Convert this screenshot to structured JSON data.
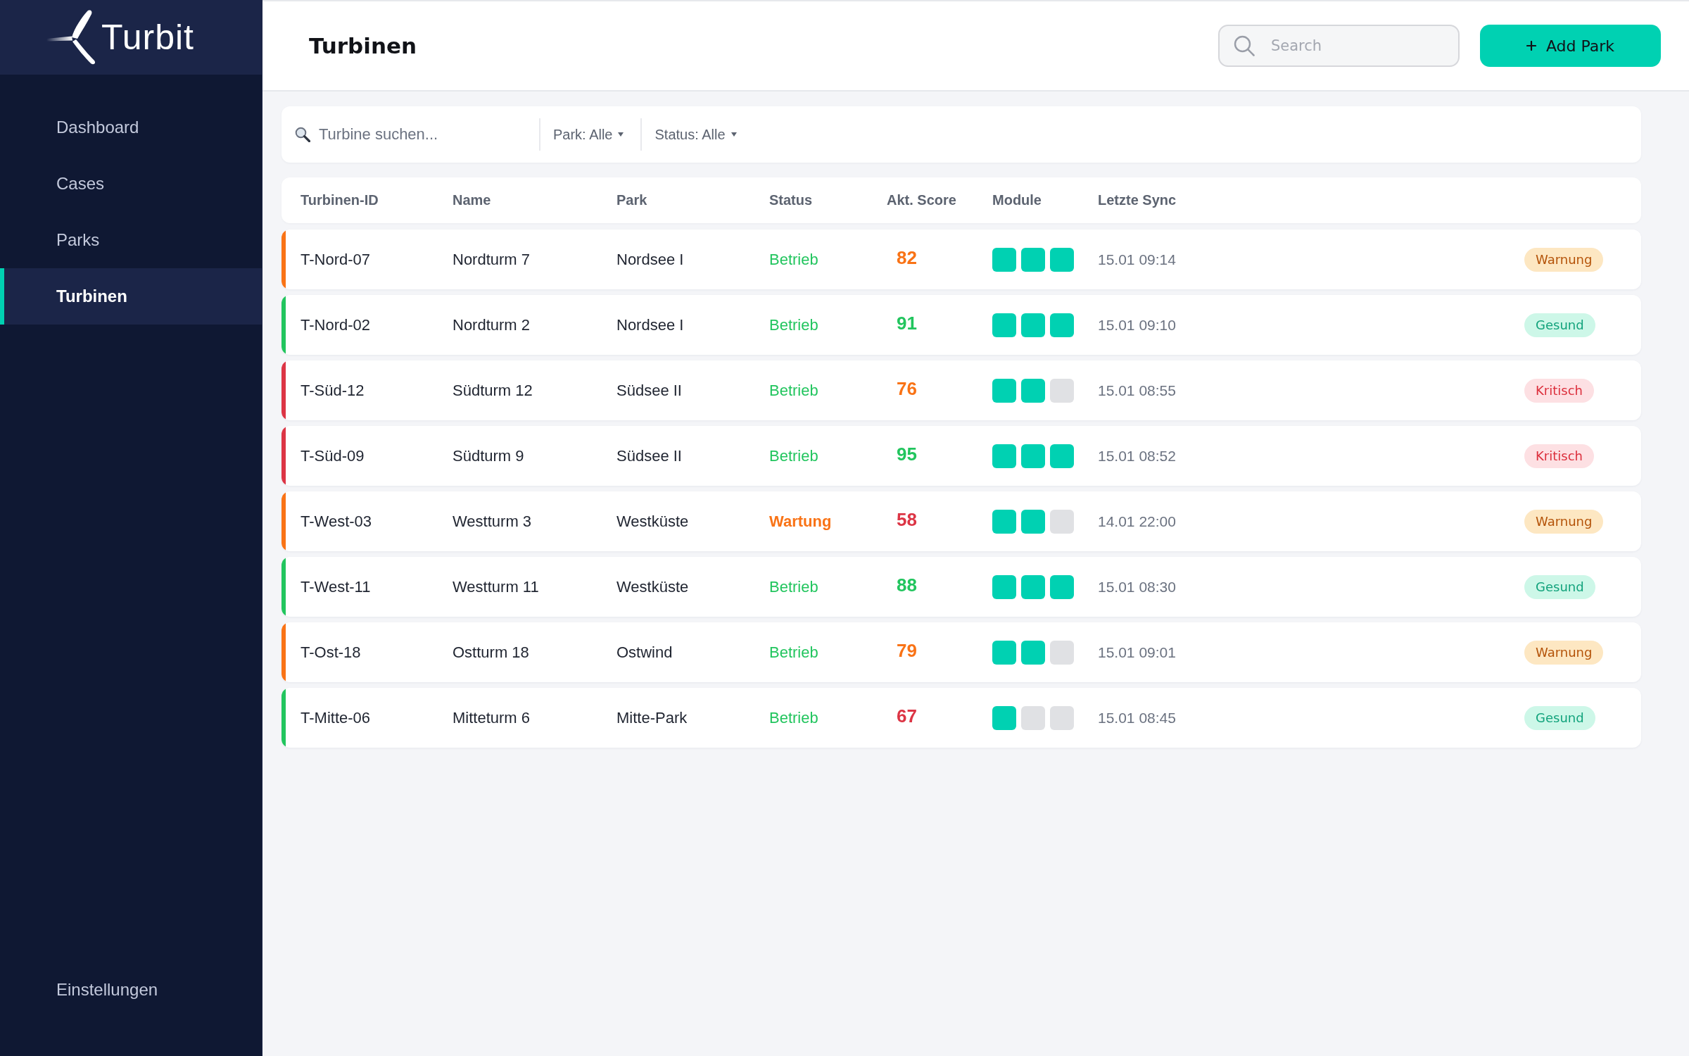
{
  "sidebar": {
    "logo": {
      "text": "Turbit"
    },
    "items": [
      {
        "label": "Dashboard",
        "selected": false
      },
      {
        "label": "Cases",
        "selected": false
      },
      {
        "label": "Parks",
        "selected": false
      },
      {
        "label": "Turbinen",
        "selected": true
      }
    ],
    "footer_items": [
      {
        "label": "Einstellungen",
        "selected": false
      }
    ]
  },
  "header": {
    "title": "Turbinen",
    "search": {
      "placeholder": "Search"
    },
    "add_button": {
      "label": "Add Park"
    }
  },
  "filters": {
    "search": {
      "placeholder": "Turbine suchen..."
    },
    "dropdowns": [
      {
        "label": "Park: Alle"
      },
      {
        "label": "Status: Alle"
      }
    ]
  },
  "table": {
    "columns": [
      "Turbinen-ID",
      "Name",
      "Park",
      "Status",
      "Akt. Score",
      "Module",
      "Letzte Sync"
    ],
    "rows": [
      {
        "color": "#f97316",
        "id": "T-Nord-07",
        "name": "Nordturm 7",
        "park": "Nordsee I",
        "status": {
          "label": "Betrieb",
          "kind": "running"
        },
        "score": {
          "value": "82",
          "color": "#f97316"
        },
        "modules": [
          {
            "on": true
          },
          {
            "on": true
          },
          {
            "on": true
          }
        ],
        "sync": "15.01 09:14",
        "badge": {
          "label": "Warnung",
          "kind": "warning"
        }
      },
      {
        "color": "#22c55e",
        "id": "T-Nord-02",
        "name": "Nordturm 2",
        "park": "Nordsee I",
        "status": {
          "label": "Betrieb",
          "kind": "running"
        },
        "score": {
          "value": "91",
          "color": "#22c55e"
        },
        "modules": [
          {
            "on": true
          },
          {
            "on": true
          },
          {
            "on": true
          }
        ],
        "sync": "15.01 09:10",
        "badge": {
          "label": "Gesund",
          "kind": "healthy"
        }
      },
      {
        "color": "#dc3545",
        "id": "T-Süd-12",
        "name": "Südturm 12",
        "park": "Südsee II",
        "status": {
          "label": "Betrieb",
          "kind": "running"
        },
        "score": {
          "value": "76",
          "color": "#f97316"
        },
        "modules": [
          {
            "on": true
          },
          {
            "on": true
          },
          {
            "on": false
          }
        ],
        "sync": "15.01 08:55",
        "badge": {
          "label": "Kritisch",
          "kind": "critical"
        }
      },
      {
        "color": "#dc3545",
        "id": "T-Süd-09",
        "name": "Südturm 9",
        "park": "Südsee II",
        "status": {
          "label": "Betrieb",
          "kind": "running"
        },
        "score": {
          "value": "95",
          "color": "#22c55e"
        },
        "modules": [
          {
            "on": true
          },
          {
            "on": true
          },
          {
            "on": true
          }
        ],
        "sync": "15.01 08:52",
        "badge": {
          "label": "Kritisch",
          "kind": "critical"
        }
      },
      {
        "color": "#f97316",
        "id": "T-West-03",
        "name": "Westturm 3",
        "park": "Westküste",
        "status": {
          "label": "Wartung",
          "kind": "maintenance"
        },
        "score": {
          "value": "58",
          "color": "#dc3545"
        },
        "modules": [
          {
            "on": true
          },
          {
            "on": true
          },
          {
            "on": false
          }
        ],
        "sync": "14.01 22:00",
        "badge": {
          "label": "Warnung",
          "kind": "warning"
        }
      },
      {
        "color": "#22c55e",
        "id": "T-West-11",
        "name": "Westturm 11",
        "park": "Westküste",
        "status": {
          "label": "Betrieb",
          "kind": "running"
        },
        "score": {
          "value": "88",
          "color": "#22c55e"
        },
        "modules": [
          {
            "on": true
          },
          {
            "on": true
          },
          {
            "on": true
          }
        ],
        "sync": "15.01 08:30",
        "badge": {
          "label": "Gesund",
          "kind": "healthy"
        }
      },
      {
        "color": "#f97316",
        "id": "T-Ost-18",
        "name": "Ostturm 18",
        "park": "Ostwind",
        "status": {
          "label": "Betrieb",
          "kind": "running"
        },
        "score": {
          "value": "79",
          "color": "#f97316"
        },
        "modules": [
          {
            "on": true
          },
          {
            "on": true
          },
          {
            "on": false
          }
        ],
        "sync": "15.01 09:01",
        "badge": {
          "label": "Warnung",
          "kind": "warning"
        }
      },
      {
        "color": "#22c55e",
        "id": "T-Mitte-06",
        "name": "Mitteturm 6",
        "park": "Mitte-Park",
        "status": {
          "label": "Betrieb",
          "kind": "running"
        },
        "score": {
          "value": "67",
          "color": "#dc3545"
        },
        "modules": [
          {
            "on": true
          },
          {
            "on": false
          },
          {
            "on": false
          }
        ],
        "sync": "15.01 08:45",
        "badge": {
          "label": "Gesund",
          "kind": "healthy"
        }
      }
    ]
  }
}
